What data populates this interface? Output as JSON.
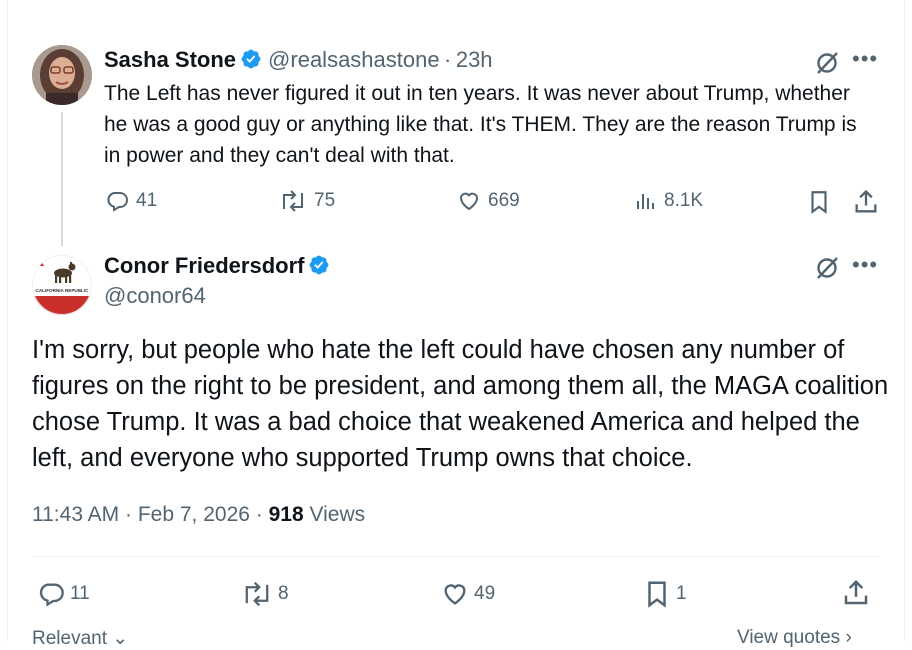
{
  "quoted_tweet": {
    "author_name": "Sasha Stone",
    "handle": "@realsashastone",
    "separator": "·",
    "time": "23h",
    "text": "The Left has never figured it out in ten years. It was never about Trump, whether he was a good guy or anything like that. It's THEM. They are the reason Trump is in power and they can't deal with that.",
    "replies": "41",
    "reposts": "75",
    "likes": "669",
    "views": "8.1K"
  },
  "main_tweet": {
    "author_name": "Conor Friedersdorf",
    "handle": "@conor64",
    "avatar_flag_text": "CALIFORNIA REPUBLIC",
    "text": "I'm sorry, but people who hate the left could have chosen any number of figures on the right to be president, and among them all, the MAGA coalition chose Trump. It was a bad choice that weakened America and helped the left, and everyone who supported Trump owns that choice.",
    "time": "11:43 AM",
    "date": "Feb 7, 2026",
    "views_count": "918",
    "views_label": "Views",
    "replies": "11",
    "reposts": "8",
    "likes": "49",
    "bookmarks": "1"
  },
  "footer": {
    "sort_label": "Relevant",
    "view_quotes_label": "View quotes"
  },
  "colors": {
    "verified_blue": "#1d9bf0",
    "text_primary": "#0f1419",
    "text_secondary": "#536471"
  },
  "icons": [
    "reply-icon",
    "repost-icon",
    "like-icon",
    "views-icon",
    "bookmark-icon",
    "share-icon",
    "grok-icon",
    "more-icon",
    "verified-icon"
  ]
}
